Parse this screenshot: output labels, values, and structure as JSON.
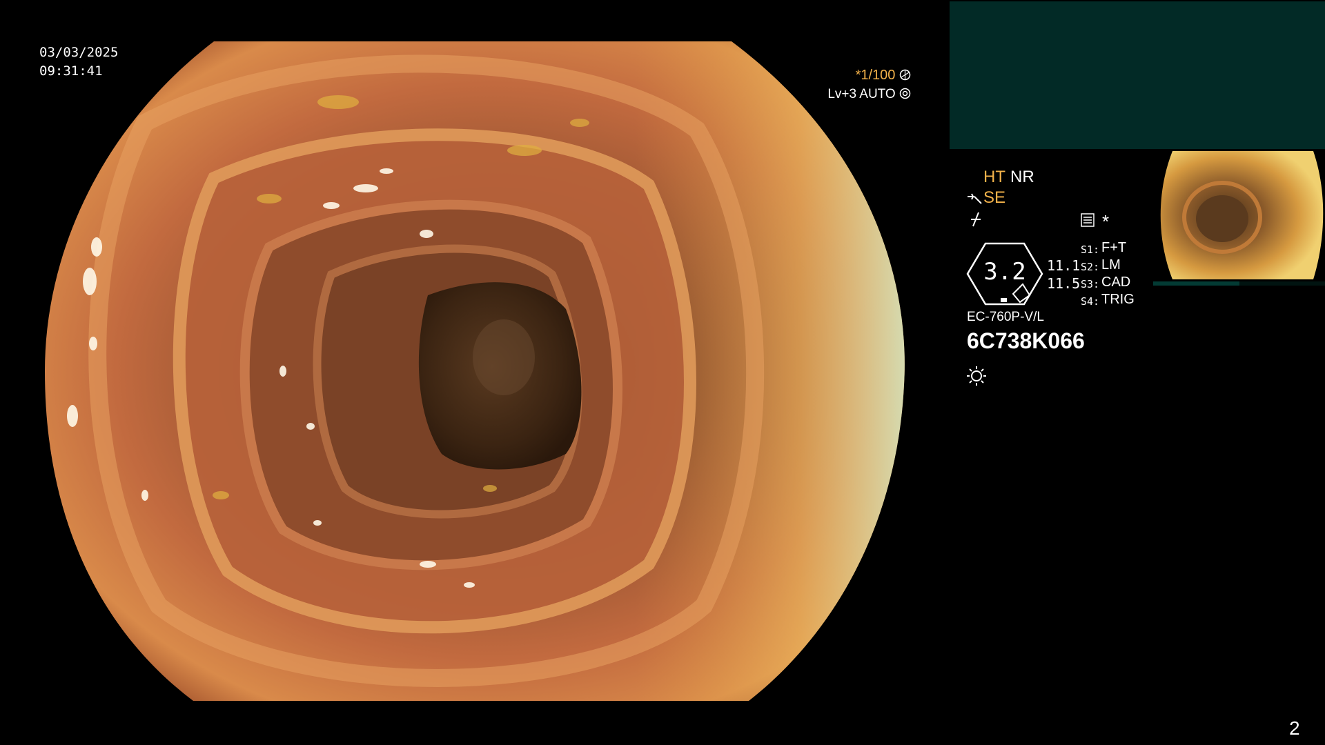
{
  "overlay": {
    "date": "03/03/2025",
    "time": "09:31:41",
    "zoom": "*1/100",
    "level": "Lv+3 AUTO"
  },
  "status": {
    "ht": "HT",
    "nr": "NR",
    "se": "SE",
    "asterisk": "*",
    "hex_value": "3.2",
    "value_1": "11.1",
    "value_2": "11.5",
    "switches": [
      {
        "key": "S1:",
        "value": "F+T"
      },
      {
        "key": "S2:",
        "value": "LM"
      },
      {
        "key": "S3:",
        "value": "CAD"
      },
      {
        "key": "S4:",
        "value": "TRIG"
      }
    ],
    "model": "EC-760P-V/L",
    "serial": "6C738K066"
  },
  "page_number": "2",
  "colors": {
    "accent_orange": "#f3b24a",
    "panel_teal": "#022a26",
    "mucosa": "#c26a3f"
  },
  "icons": [
    "shutter-icon",
    "iris-icon",
    "wand-icon",
    "flash-icon",
    "menu-icon",
    "sun-icon"
  ]
}
